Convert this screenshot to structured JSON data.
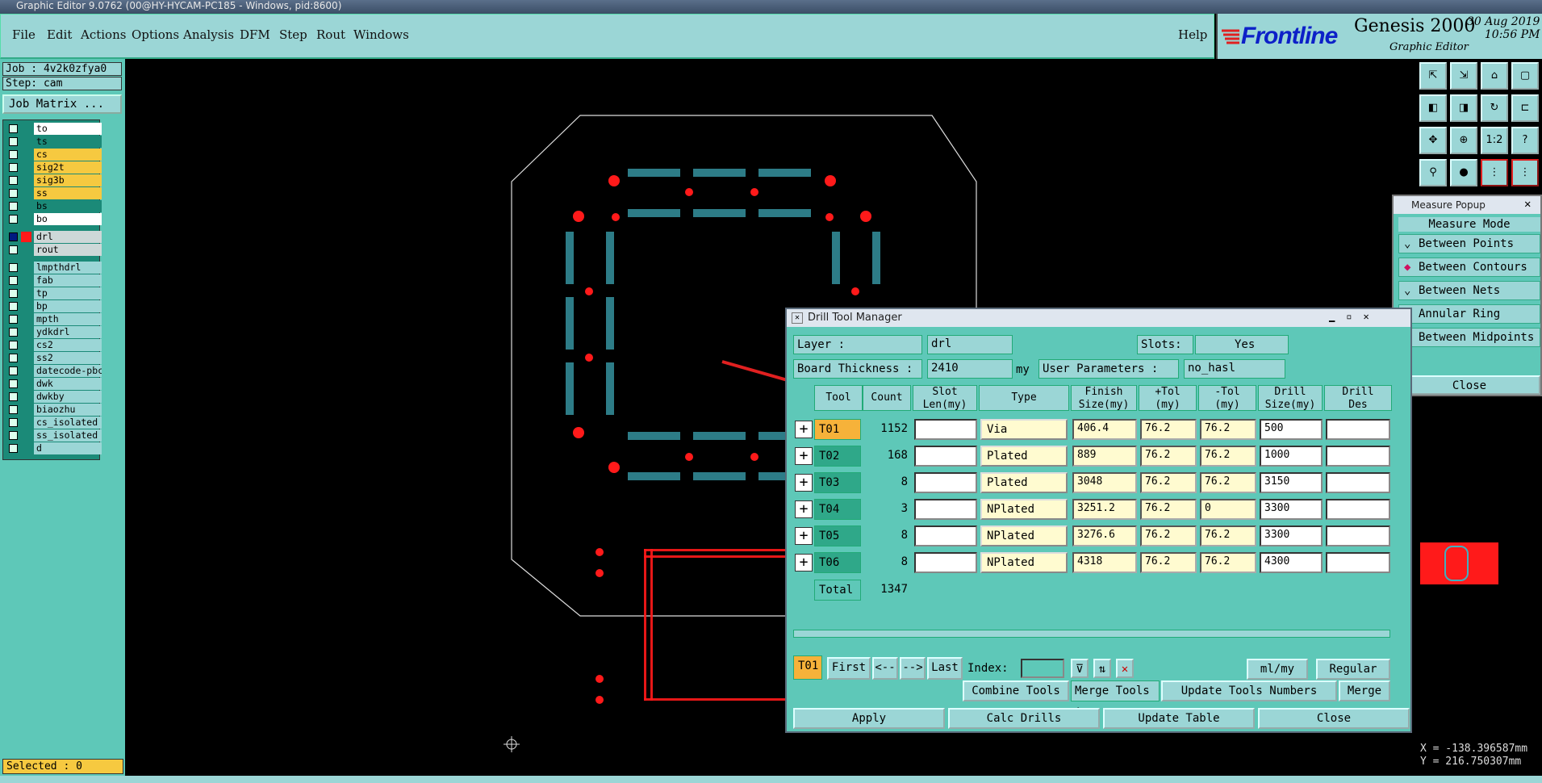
{
  "window": {
    "title": "Graphic Editor 9.0762 (00@HY-HYCAM-PC185 - Windows, pid:8600)"
  },
  "menu": {
    "items": [
      "File",
      "Edit",
      "Actions",
      "Options",
      "Analysis",
      "DFM",
      "Step",
      "Rout",
      "Windows"
    ],
    "help": "Help"
  },
  "brand": {
    "logo": "Frontline",
    "product": "Genesis 2000",
    "subtitle": "Graphic Editor",
    "date": "30 Aug 2019",
    "time": "10:56 PM"
  },
  "job": {
    "job_label": "Job : 4v2k0zfya0",
    "step_label": "Step: cam",
    "matrix_button": "Job Matrix ..."
  },
  "layers": [
    {
      "name": "to",
      "color": "#ffffff"
    },
    {
      "name": "ts",
      "color": "#1b8a78"
    },
    {
      "name": "cs",
      "color": "#f6c940"
    },
    {
      "name": "sig2t",
      "color": "#f6c940"
    },
    {
      "name": "sig3b",
      "color": "#f6c940"
    },
    {
      "name": "ss",
      "color": "#f6c940"
    },
    {
      "name": "bs",
      "color": "#1b8a78"
    },
    {
      "name": "bo",
      "color": "#ffffff"
    },
    {
      "name": "drl",
      "color": "#cdd8d8"
    },
    {
      "name": "rout",
      "color": "#cdd8d8"
    },
    {
      "name": "lmpthdrl",
      "color": "#9bd6d6"
    },
    {
      "name": "fab",
      "color": "#9bd6d6"
    },
    {
      "name": "tp",
      "color": "#9bd6d6"
    },
    {
      "name": "bp",
      "color": "#9bd6d6"
    },
    {
      "name": "mpth",
      "color": "#9bd6d6"
    },
    {
      "name": "ydkdrl",
      "color": "#9bd6d6"
    },
    {
      "name": "cs2",
      "color": "#9bd6d6"
    },
    {
      "name": "ss2",
      "color": "#9bd6d6"
    },
    {
      "name": "datecode-pbc",
      "color": "#9bd6d6"
    },
    {
      "name": "dwk",
      "color": "#9bd6d6"
    },
    {
      "name": "dwkby",
      "color": "#9bd6d6"
    },
    {
      "name": "biaozhu",
      "color": "#9bd6d6"
    },
    {
      "name": "cs_isolated",
      "color": "#9bd6d6"
    },
    {
      "name": "ss_isolated",
      "color": "#9bd6d6"
    },
    {
      "name": "d",
      "color": "#9bd6d6"
    }
  ],
  "status": {
    "selected": "Selected : 0"
  },
  "toolbox": {
    "scale_label": "1:2",
    "help_label": "?"
  },
  "measure": {
    "title": "Measure Popup",
    "mode_header": "Measure Mode",
    "options": [
      "Between Points",
      "Between Contours",
      "Between Nets",
      "Annular Ring",
      "Between Midpoints"
    ],
    "selected_option": "Between Contours",
    "close": "Close"
  },
  "drill": {
    "title": "Drill Tool Manager",
    "layer_label": "Layer          :",
    "layer_value": "drl",
    "slots_label": "Slots:",
    "slots_value": "Yes",
    "board_label": "Board Thickness  :",
    "board_value": "2410",
    "board_unit": "my",
    "userparam_label": "User Parameters :",
    "userparam_value": "no_hasl",
    "columns": [
      "Tool",
      "Count",
      "Slot\nLen(my)",
      "Type",
      "Finish\nSize(my)",
      "+Tol\n(my)",
      "-Tol\n(my)",
      "Drill\nSize(my)",
      "Drill\nDes"
    ],
    "rows": [
      {
        "tool": "T01",
        "count": "1152",
        "type": "Via",
        "finish": "406.4",
        "ptol": "76.2",
        "mtol": "76.2",
        "drill": "500"
      },
      {
        "tool": "T02",
        "count": "168",
        "type": "Plated",
        "finish": "889",
        "ptol": "76.2",
        "mtol": "76.2",
        "drill": "1000"
      },
      {
        "tool": "T03",
        "count": "8",
        "type": "Plated",
        "finish": "3048",
        "ptol": "76.2",
        "mtol": "76.2",
        "drill": "3150"
      },
      {
        "tool": "T04",
        "count": "3",
        "type": "NPlated",
        "finish": "3251.2",
        "ptol": "76.2",
        "mtol": "0",
        "drill": "3300"
      },
      {
        "tool": "T05",
        "count": "8",
        "type": "NPlated",
        "finish": "3276.6",
        "ptol": "76.2",
        "mtol": "76.2",
        "drill": "3300"
      },
      {
        "tool": "T06",
        "count": "8",
        "type": "NPlated",
        "finish": "4318",
        "ptol": "76.2",
        "mtol": "76.2",
        "drill": "4300"
      }
    ],
    "total_label": "Total",
    "total_value": "1347",
    "current_tool": "T01",
    "nav": {
      "first": "First",
      "prev": "<--",
      "next": "-->",
      "last": "Last",
      "index_label": "Index:"
    },
    "units": "ml/my",
    "mode": "Regular",
    "combine": "Combine Tools",
    "merge_label": "Merge Tools :",
    "update_numbers": "Update Tools Numbers",
    "merge": "Merge",
    "apply": "Apply",
    "calc": "Calc Drills",
    "update_table": "Update Table",
    "close": "Close"
  },
  "coords": {
    "x": "X = -138.396587mm",
    "y": "Y = 216.750307mm"
  }
}
